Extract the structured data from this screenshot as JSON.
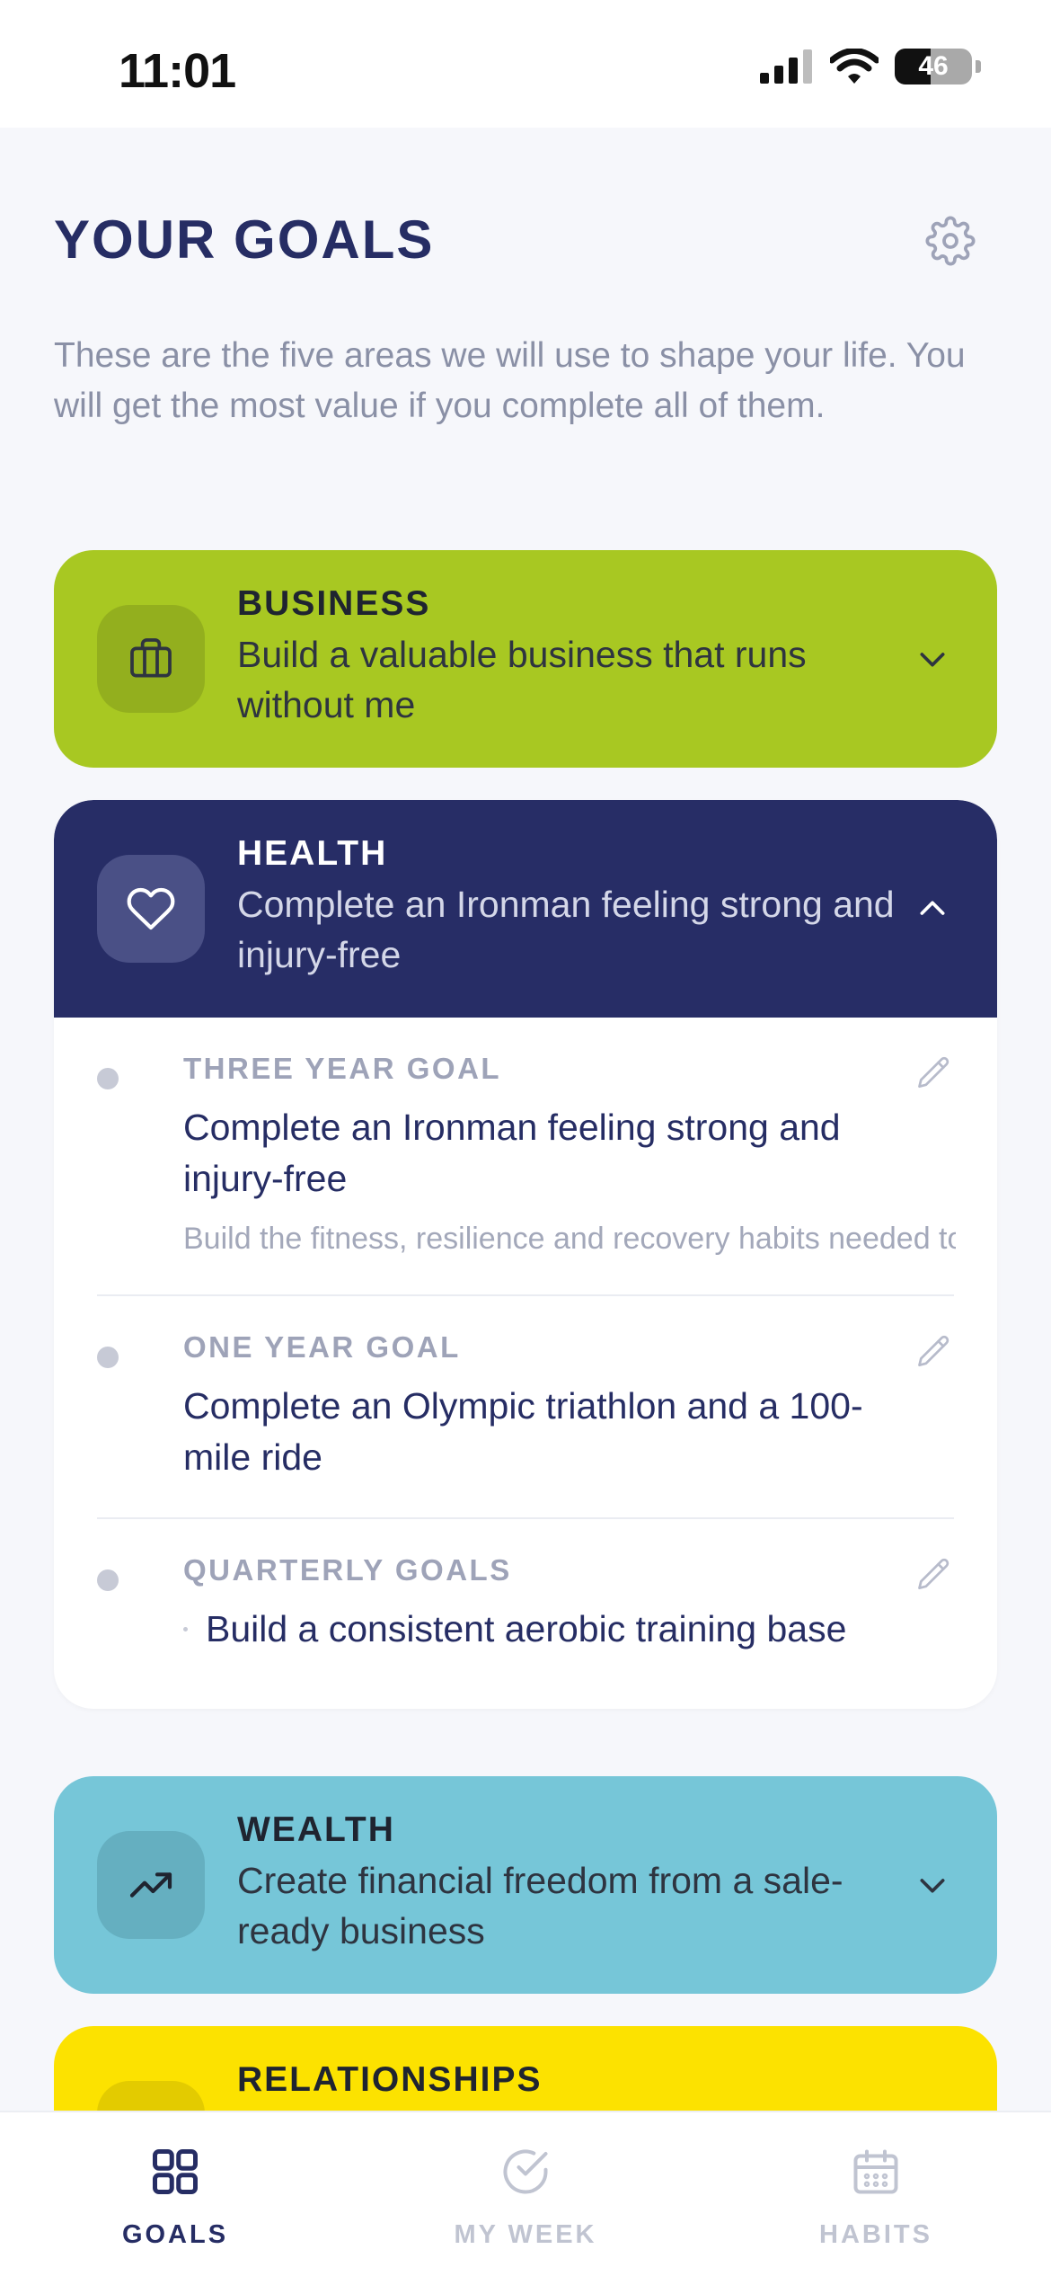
{
  "status_bar": {
    "time": "11:01",
    "battery": "46"
  },
  "header": {
    "title": "YOUR GOALS"
  },
  "intro": "These are the five areas we will use to shape your life. You will get the most value if you complete all of them.",
  "areas": [
    {
      "key": "business",
      "label": "BUSINESS",
      "description": "Build a valuable business that runs without me",
      "color": "#A8C822",
      "icon": "briefcase-icon",
      "expanded": false
    },
    {
      "key": "health",
      "label": "HEALTH",
      "description": "Complete an Ironman feeling strong and injury-free",
      "color": "#272D66",
      "icon": "heart-icon",
      "expanded": true,
      "goals": {
        "three_year": {
          "label": "THREE YEAR GOAL",
          "text": "Complete an Ironman feeling strong and injury-free",
          "detail": "Build the fitness, resilience and recovery habits needed to complete an Ironman while maintaining..."
        },
        "one_year": {
          "label": "ONE YEAR GOAL",
          "text": "Complete an Olympic triathlon and a 100-mile ride"
        },
        "quarterly": {
          "label": "QUARTERLY GOALS",
          "items": [
            "Build a consistent aerobic training base"
          ]
        }
      }
    },
    {
      "key": "wealth",
      "label": "WEALTH",
      "description": "Create financial freedom from a sale-ready business",
      "color": "#76C6D8",
      "icon": "trending-up-icon",
      "expanded": false
    },
    {
      "key": "relationships",
      "label": "RELATIONSHIPS",
      "color": "#FCE200",
      "icon": "people-icon",
      "expanded": false
    }
  ],
  "tabbar": [
    {
      "label": "GOALS",
      "icon": "grid-icon",
      "active": true
    },
    {
      "label": "MY WEEK",
      "icon": "check-circle-icon",
      "active": false
    },
    {
      "label": "HABITS",
      "icon": "calendar-icon",
      "active": false
    }
  ],
  "colors": {
    "primary": "#262D64",
    "muted": "#8A90A6",
    "background": "#F6F7FB"
  }
}
